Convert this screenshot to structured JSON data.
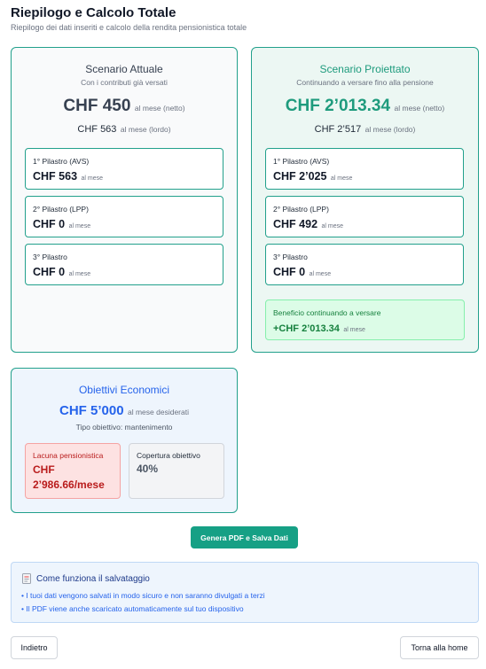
{
  "header": {
    "title": "Riepilogo e Calcolo Totale",
    "subtitle": "Riepilogo dei dati inseriti e calcolo della rendita pensionistica totale"
  },
  "current": {
    "title": "Scenario Attuale",
    "subtitle": "Con i contributi già versati",
    "net_amount": "CHF 450",
    "net_unit": "al mese (netto)",
    "gross_amount": "CHF 563",
    "gross_unit": "al mese (lordo)",
    "pillars": [
      {
        "label": "1° Pilastro (AVS)",
        "amount": "CHF 563",
        "unit": "al mese"
      },
      {
        "label": "2° Pilastro (LPP)",
        "amount": "CHF 0",
        "unit": "al mese"
      },
      {
        "label": "3° Pilastro",
        "amount": "CHF 0",
        "unit": "al mese"
      }
    ]
  },
  "projected": {
    "title": "Scenario Proiettato",
    "subtitle": "Continuando a versare fino alla pensione",
    "net_amount": "CHF 2’013.34",
    "net_unit": "al mese (netto)",
    "gross_amount": "CHF 2’517",
    "gross_unit": "al mese (lordo)",
    "pillars": [
      {
        "label": "1° Pilastro (AVS)",
        "amount": "CHF 2’025",
        "unit": "al mese"
      },
      {
        "label": "2° Pilastro (LPP)",
        "amount": "CHF 492",
        "unit": "al mese"
      },
      {
        "label": "3° Pilastro",
        "amount": "CHF 0",
        "unit": "al mese"
      }
    ],
    "benefit": {
      "label": "Beneficio continuando a versare",
      "amount": "+CHF 2’013.34",
      "unit": "al mese"
    }
  },
  "goals": {
    "title": "Obiettivi Economici",
    "amount": "CHF 5’000",
    "unit": "al mese desiderati",
    "type": "Tipo obiettivo: mantenimento",
    "gap_label": "Lacuna pensionistica",
    "gap_value": "CHF 2’986.66/mese",
    "coverage_label": "Copertura obiettivo",
    "coverage_value": "40%"
  },
  "actions": {
    "generate_label": "Genera PDF e Salva Dati",
    "back_label": "Indietro",
    "home_label": "Torna alla home"
  },
  "info": {
    "icon": "document-icon",
    "title": "Come funziona il salvataggio",
    "lines": [
      "• I tuoi dati vengono salvati in modo sicuro e non saranno divulgati a terzi",
      "• Il PDF viene anche scaricato automaticamente sul tuo dispositivo"
    ]
  },
  "colors": {
    "accent": "#16a085",
    "projected_text": "#1e9b7d",
    "current_title": "#374151",
    "goals_blue": "#2563eb",
    "danger": "#b91c1c",
    "success": "#15803d"
  }
}
